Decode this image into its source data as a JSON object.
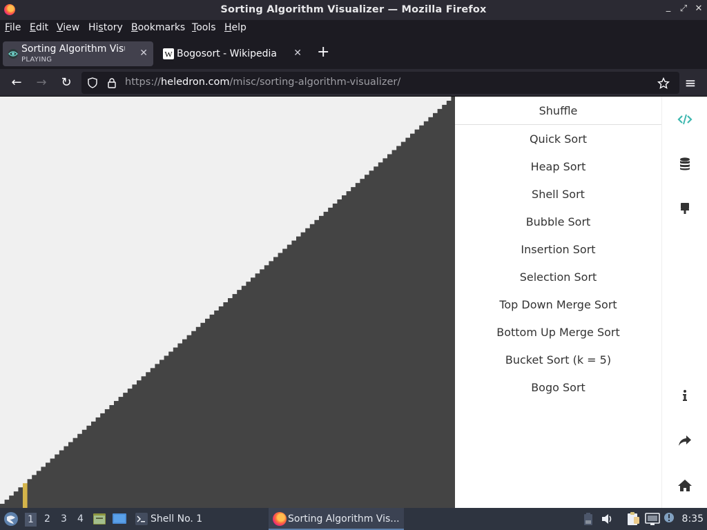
{
  "window": {
    "title": "Sorting Algorithm Visualizer — Mozilla Firefox",
    "controls": [
      "_",
      "⤢",
      "✕"
    ]
  },
  "menubar": {
    "items": [
      {
        "label": "File",
        "accel": "F"
      },
      {
        "label": "Edit",
        "accel": "E"
      },
      {
        "label": "View",
        "accel": "V"
      },
      {
        "label": "History",
        "accel": "s"
      },
      {
        "label": "Bookmarks",
        "accel": "B"
      },
      {
        "label": "Tools",
        "accel": "T"
      },
      {
        "label": "Help",
        "accel": "H"
      }
    ]
  },
  "tabs": [
    {
      "title": "Sorting Algorithm Visualiz",
      "subtitle": "PLAYING",
      "active": true,
      "icon": "visualizer-favicon"
    },
    {
      "title": "Bogosort - Wikipedia",
      "subtitle": "",
      "active": false,
      "icon": "wikipedia-favicon"
    }
  ],
  "tab_close": "✕",
  "new_tab": "+",
  "navigation": {
    "back": "←",
    "forward": "→",
    "reload": "↻",
    "url_prefix": "https://",
    "url_domain": "heledron.com",
    "url_path": "/misc/sorting-algorithm-visualizer/",
    "menu": "≡"
  },
  "visualizer": {
    "bar_count": 100,
    "highlight_index": 5,
    "colors": {
      "bar": "#444444",
      "background": "#f0f0f0",
      "highlight": "#d4b44a"
    }
  },
  "sort_menu": {
    "shuffle": "Shuffle",
    "algorithms": [
      "Quick Sort",
      "Heap Sort",
      "Shell Sort",
      "Bubble Sort",
      "Insertion Sort",
      "Selection Sort",
      "Top Down Merge Sort",
      "Bottom Up Merge Sort",
      "Bucket Sort (k = 5)",
      "Bogo Sort"
    ]
  },
  "side_icons": {
    "code": "code-icon",
    "database": "database-icon",
    "brush": "brush-icon",
    "info": "info-icon",
    "share": "share-icon",
    "home": "home-icon"
  },
  "taskbar": {
    "workspaces": [
      "1",
      "2",
      "3",
      "4"
    ],
    "shell_label": "Shell No. 1",
    "firefox_label": "Sorting Algorithm Vis...",
    "clock": "8:35"
  }
}
